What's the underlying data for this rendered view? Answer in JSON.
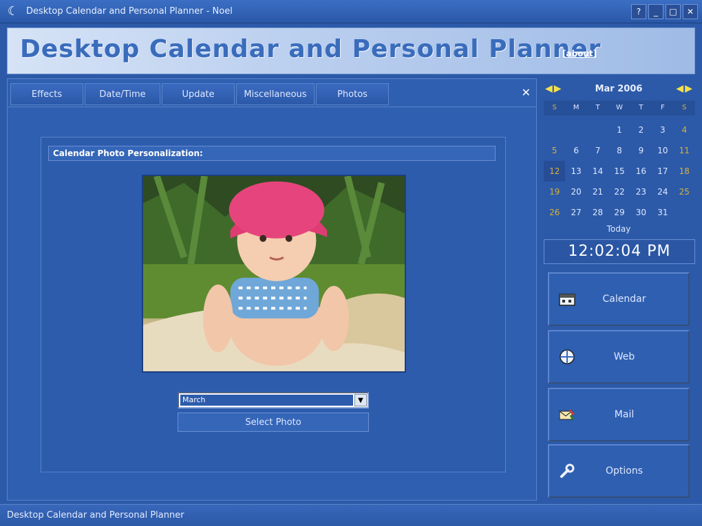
{
  "window": {
    "title": "Desktop Calendar and Personal Planner - Noel",
    "buttons": {
      "help": "?",
      "minimize": "_",
      "maximize": "□",
      "close": "✕"
    }
  },
  "banner": {
    "title": "Desktop Calendar and Personal Planner",
    "link": "[about]"
  },
  "tabs": [
    {
      "label": "Effects"
    },
    {
      "label": "Date/Time"
    },
    {
      "label": "Update"
    },
    {
      "label": "Miscellaneous"
    },
    {
      "label": "Photos"
    }
  ],
  "tab_close": "✕",
  "photo_panel": {
    "header": "Calendar Photo Personalization:",
    "month_select": "March",
    "select_photo_button": "Select Photo"
  },
  "calendar": {
    "title": "Mar 2006",
    "weekdays": [
      "S",
      "M",
      "T",
      "W",
      "T",
      "F",
      "S"
    ],
    "days": [
      "",
      "",
      "",
      "1",
      "2",
      "3",
      "4",
      "5",
      "6",
      "7",
      "8",
      "9",
      "10",
      "11",
      "12",
      "13",
      "14",
      "15",
      "16",
      "17",
      "18",
      "19",
      "20",
      "21",
      "22",
      "23",
      "24",
      "25",
      "26",
      "27",
      "28",
      "29",
      "30",
      "31",
      ""
    ],
    "today_day": "12"
  },
  "today": {
    "label": "Today",
    "time": "12:02:04 PM"
  },
  "nav": [
    {
      "label": "Calendar",
      "icon": "calendar-icon"
    },
    {
      "label": "Web",
      "icon": "web-icon"
    },
    {
      "label": "Mail",
      "icon": "mail-icon"
    },
    {
      "label": "Options",
      "icon": "wrench-icon"
    }
  ],
  "statusbar": {
    "text": "Desktop Calendar and Personal Planner"
  },
  "colors": {
    "background": "#2c5aa8",
    "weekend": "#d6b23a",
    "arrow": "#f4e04a"
  }
}
